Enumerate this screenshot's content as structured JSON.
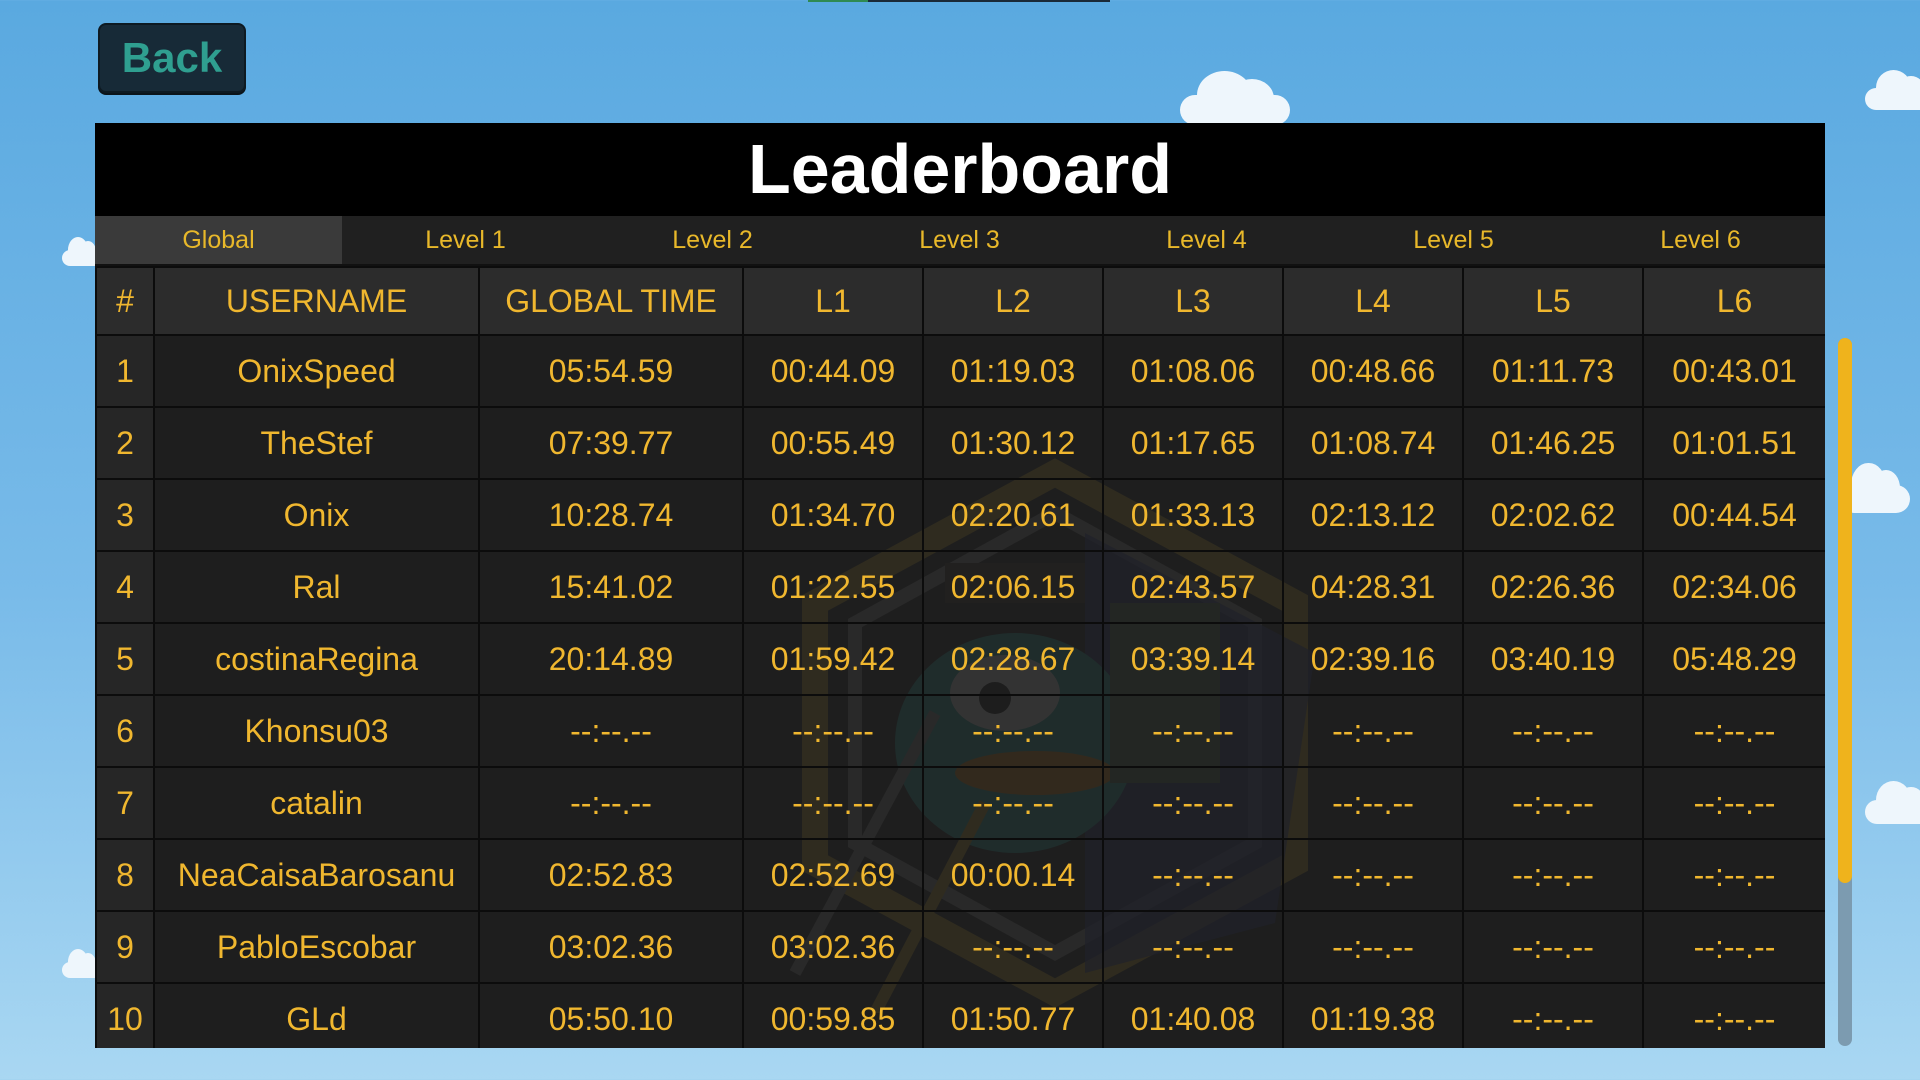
{
  "back": {
    "label": "Back"
  },
  "title": "Leaderboard",
  "tabs": [
    "Global",
    "Level 1",
    "Level 2",
    "Level 3",
    "Level 4",
    "Level 5",
    "Level 6"
  ],
  "active_tab": "Global",
  "columns": [
    "#",
    "USERNAME",
    "GLOBAL TIME",
    "L1",
    "L2",
    "L3",
    "L4",
    "L5",
    "L6"
  ],
  "rows": [
    [
      "1",
      "OnixSpeed",
      "05:54.59",
      "00:44.09",
      "01:19.03",
      "01:08.06",
      "00:48.66",
      "01:11.73",
      "00:43.01"
    ],
    [
      "2",
      "TheStef",
      "07:39.77",
      "00:55.49",
      "01:30.12",
      "01:17.65",
      "01:08.74",
      "01:46.25",
      "01:01.51"
    ],
    [
      "3",
      "Onix",
      "10:28.74",
      "01:34.70",
      "02:20.61",
      "01:33.13",
      "02:13.12",
      "02:02.62",
      "00:44.54"
    ],
    [
      "4",
      "Ral",
      "15:41.02",
      "01:22.55",
      "02:06.15",
      "02:43.57",
      "04:28.31",
      "02:26.36",
      "02:34.06"
    ],
    [
      "5",
      "costinaRegina",
      "20:14.89",
      "01:59.42",
      "02:28.67",
      "03:39.14",
      "02:39.16",
      "03:40.19",
      "05:48.29"
    ],
    [
      "6",
      "Khonsu03",
      "--:--.--",
      "--:--.--",
      "--:--.--",
      "--:--.--",
      "--:--.--",
      "--:--.--",
      "--:--.--"
    ],
    [
      "7",
      "catalin",
      "--:--.--",
      "--:--.--",
      "--:--.--",
      "--:--.--",
      "--:--.--",
      "--:--.--",
      "--:--.--"
    ],
    [
      "8",
      "NeaCaisaBarosanu",
      "02:52.83",
      "02:52.69",
      "00:00.14",
      "--:--.--",
      "--:--.--",
      "--:--.--",
      "--:--.--"
    ],
    [
      "9",
      "PabloEscobar",
      "03:02.36",
      "03:02.36",
      "--:--.--",
      "--:--.--",
      "--:--.--",
      "--:--.--",
      "--:--.--"
    ],
    [
      "10",
      "GLd",
      "05:50.10",
      "00:59.85",
      "01:50.77",
      "01:40.08",
      "01:19.38",
      "--:--.--",
      "--:--.--"
    ]
  ],
  "scroll": {
    "position": 0.0,
    "visible_fraction": 0.77
  },
  "colors": {
    "accent": "#f0b72f",
    "back_text": "#2f9f90",
    "sky": "#5aa9e0"
  }
}
